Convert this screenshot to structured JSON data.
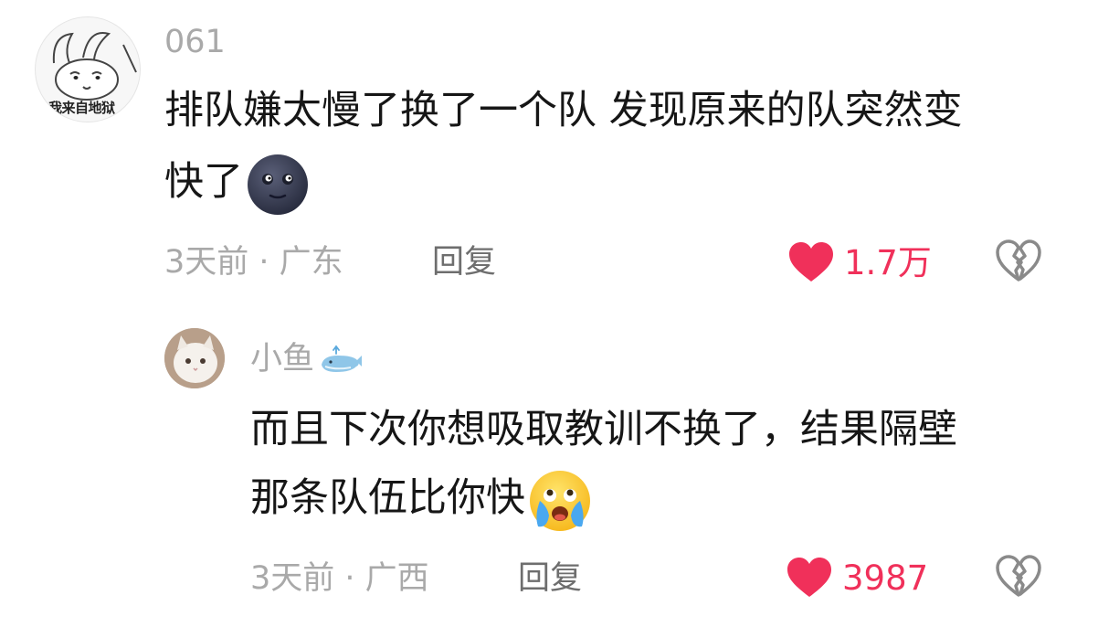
{
  "comments": [
    {
      "username": "061",
      "avatar_caption": "我来自地狱",
      "avatar_icon": "rabbit-avatar-icon",
      "text_line1": "排队嫌太慢了换了一个队 发现原来的队突然变",
      "text_line2": "快了",
      "emoji": "new-moon-face-icon",
      "time_location": "3天前 · 广东",
      "reply_label": "回复",
      "likes": "1.7万"
    },
    {
      "username": "小鱼",
      "username_emoji": "whale-icon",
      "avatar_icon": "cat-avatar-icon",
      "text_line1": "而且下次你想吸取教训不换了，结果隔壁",
      "text_line2": "那条队伍比你快",
      "emoji": "crying-face-icon",
      "time_location": "3天前 · 广西",
      "reply_label": "回复",
      "likes": "3987"
    }
  ],
  "colors": {
    "like_red": "#f0305a",
    "meta_gray": "#a9a9a9",
    "reply_gray": "#6e6e6e",
    "text": "#161616"
  }
}
